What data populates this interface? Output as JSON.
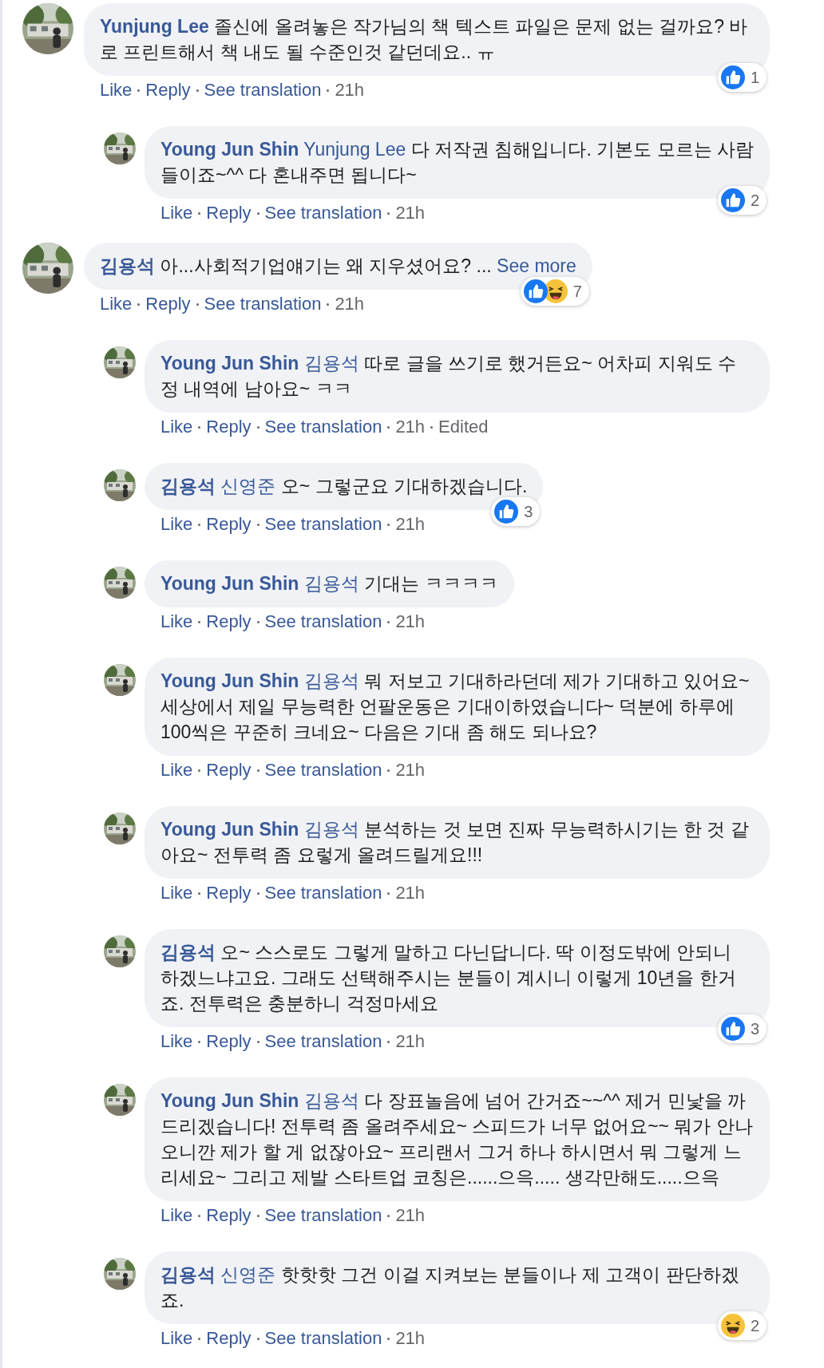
{
  "comments": [
    {
      "author": "Yunjung Lee",
      "text": "졸신에 올려놓은 작가님의 책 텍스트 파일은 문제 없는 걸까요? 바로 프린트해서 책 내도 될 수준인것 같던데요.. ㅠ",
      "actions": [
        "Like",
        "Reply",
        "See translation"
      ],
      "time": "21h",
      "reactions": {
        "like": true,
        "haha": false,
        "count": "1"
      },
      "replies": [
        {
          "author": "Young Jun Shin",
          "mention": "Yunjung Lee",
          "text": "다 저작권 침해입니다. 기본도 모르는 사람들이죠~^^ 다 혼내주면 됩니다~",
          "actions": [
            "Like",
            "Reply",
            "See translation"
          ],
          "time": "21h",
          "reactions": {
            "like": true,
            "haha": false,
            "count": "2"
          }
        }
      ]
    },
    {
      "author": "김용석",
      "text": "아...사회적기업얘기는 왜 지우셨어요? ...",
      "see_more": "See more",
      "actions": [
        "Like",
        "Reply",
        "See translation"
      ],
      "time": "21h",
      "reactions": {
        "like": true,
        "haha": true,
        "count": "7"
      },
      "replies": [
        {
          "author": "Young Jun Shin",
          "mention": "김용석",
          "text": "따로 글을 쓰기로 했거든요~ 어차피 지워도 수정 내역에 남아요~ ㅋㅋ",
          "actions": [
            "Like",
            "Reply",
            "See translation"
          ],
          "time": "21h",
          "edited": "Edited"
        },
        {
          "author": "김용석",
          "mention": "신영준",
          "text": "오~ 그렇군요 기대하겠습니다.",
          "actions": [
            "Like",
            "Reply",
            "See translation"
          ],
          "time": "21h",
          "reactions": {
            "like": true,
            "haha": false,
            "count": "3"
          }
        },
        {
          "author": "Young Jun Shin",
          "mention": "김용석",
          "text": "기대는 ㅋㅋㅋㅋ",
          "actions": [
            "Like",
            "Reply",
            "See translation"
          ],
          "time": "21h"
        },
        {
          "author": "Young Jun Shin",
          "mention": "김용석",
          "text": "뭐 저보고 기대하라던데 제가 기대하고 있어요~ 세상에서 제일 무능력한 언팔운동은 기대이하였습니다~ 덕분에 하루에 100씩은 꾸준히 크네요~ 다음은 기대 좀 해도 되나요?",
          "actions": [
            "Like",
            "Reply",
            "See translation"
          ],
          "time": "21h"
        },
        {
          "author": "Young Jun Shin",
          "mention": "김용석",
          "text": "분석하는 것 보면 진짜 무능력하시기는 한 것 같아요~ 전투력 좀 요렇게 올려드릴게요!!!",
          "actions": [
            "Like",
            "Reply",
            "See translation"
          ],
          "time": "21h"
        },
        {
          "author": "김용석",
          "text": "오~ 스스로도 그렇게 말하고 다닌답니다. 딱 이정도밖에 안되니 하겠느냐고요. 그래도 선택해주시는 분들이 계시니 이렇게 10년을 한거죠. 전투력은 충분하니 걱정마세요",
          "actions": [
            "Like",
            "Reply",
            "See translation"
          ],
          "time": "21h",
          "reactions": {
            "like": true,
            "haha": false,
            "count": "3"
          }
        },
        {
          "author": "Young Jun Shin",
          "mention": "김용석",
          "text": "다 장표놀음에 넘어 간거죠~~^^ 제거 민낯을 까드리겠습니다! 전투력 좀 올려주세요~ 스피드가 너무 없어요~~ 뭐가 안나오니깐 제가 할 게 없잖아요~ 프리랜서 그거 하나 하시면서 뭐 그렇게 느리세요~ 그리고 제발 스타트업 코칭은......으윽..... 생각만해도.....으윽",
          "actions": [
            "Like",
            "Reply",
            "See translation"
          ],
          "time": "21h"
        },
        {
          "author": "김용석",
          "mention": "신영준",
          "text": "핫핫핫 그건 이걸 지켜보는 분들이나 제 고객이 판단하겠죠.",
          "actions": [
            "Like",
            "Reply",
            "See translation"
          ],
          "time": "21h",
          "reactions": {
            "like": false,
            "haha": true,
            "count": "2"
          }
        }
      ]
    }
  ]
}
